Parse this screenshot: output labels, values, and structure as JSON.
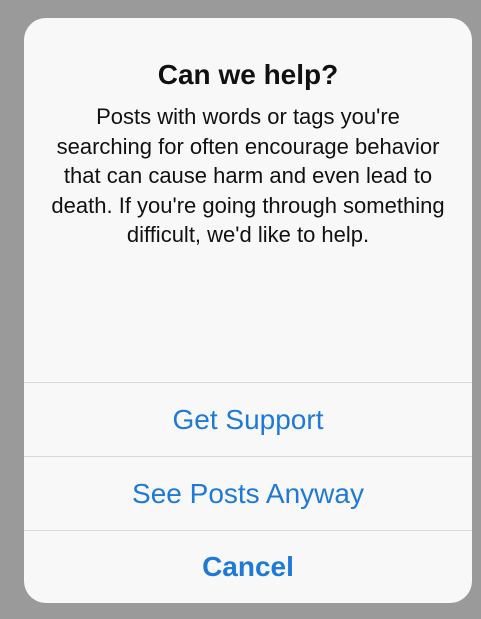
{
  "dialog": {
    "title": "Can we help?",
    "message": "Posts with words or tags you're searching for often encourage behavior that can cause harm and even lead to death. If you're going through something difficult, we'd like to help.",
    "actions": {
      "get_support": "Get Support",
      "see_posts_anyway": "See Posts Anyway",
      "cancel": "Cancel"
    }
  },
  "colors": {
    "backdrop": "#9a9a9a",
    "dialog_background": "#f8f8f8",
    "action_text": "#1e7ad6",
    "body_text": "#111111",
    "separator": "#d9d9dc"
  }
}
